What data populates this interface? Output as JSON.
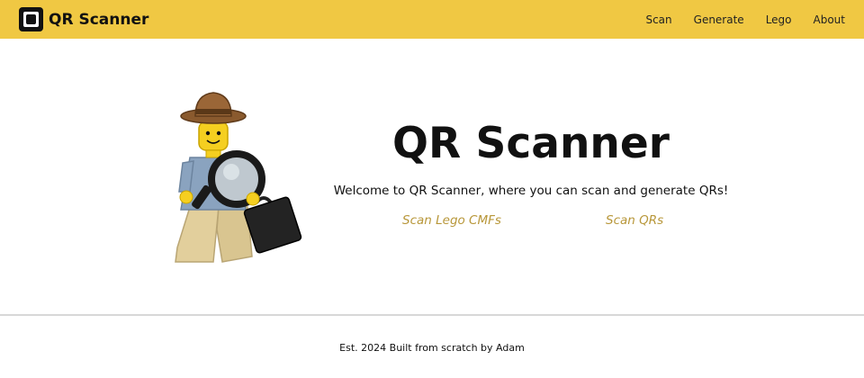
{
  "navbar": {
    "logo_icon": "qr-square-icon",
    "brand": "QR Scanner",
    "links": [
      "Scan",
      "Generate",
      "Lego",
      "About"
    ],
    "background": "#f0c843"
  },
  "hero": {
    "image_icon": "lego-explorer-minifigure-with-magnifying-glass",
    "title": "QR Scanner",
    "subtitle": "Welcome to QR Scanner, where you can scan and generate QRs!",
    "links": [
      "Scan Lego CMFs",
      "Scan QRs"
    ],
    "link_color": "#b8973a"
  },
  "footer": {
    "text": "Est. 2024 Built from scratch by Adam"
  }
}
